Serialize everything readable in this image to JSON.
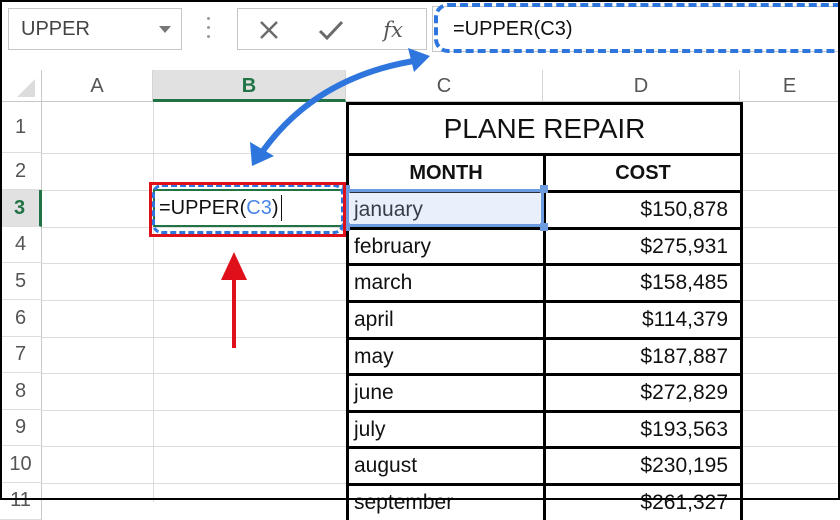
{
  "toolbar": {
    "name_box": "UPPER",
    "cancel_icon": "close-icon",
    "enter_icon": "checkmark-icon",
    "fx_label": "fx",
    "formula": "=UPPER(C3)"
  },
  "columns": [
    "A",
    "B",
    "C",
    "D",
    "E"
  ],
  "selected_column": "B",
  "rows": [
    "1",
    "2",
    "3",
    "4",
    "5",
    "6",
    "7",
    "8",
    "9",
    "10",
    "11"
  ],
  "selected_row": "3",
  "active_cell": {
    "address": "B3",
    "prefix": "=UPPER(",
    "ref": "C3",
    "suffix": ")"
  },
  "table": {
    "title": "PLANE REPAIR",
    "headers": [
      "MONTH",
      "COST"
    ],
    "rows": [
      {
        "month": "january",
        "cost": "$150,878"
      },
      {
        "month": "february",
        "cost": "$275,931"
      },
      {
        "month": "march",
        "cost": "$158,485"
      },
      {
        "month": "april",
        "cost": "$114,379"
      },
      {
        "month": "may",
        "cost": "$187,887"
      },
      {
        "month": "june",
        "cost": "$272,829"
      },
      {
        "month": "july",
        "cost": "$193,563"
      },
      {
        "month": "august",
        "cost": "$230,195"
      },
      {
        "month": "september",
        "cost": "$261,327"
      }
    ]
  },
  "annotations": {
    "formula_highlight_color": "#2e76dd",
    "cell_highlight_color": "#e0101a",
    "arrow_colors": [
      "#2e76dd",
      "#e0101a"
    ]
  }
}
